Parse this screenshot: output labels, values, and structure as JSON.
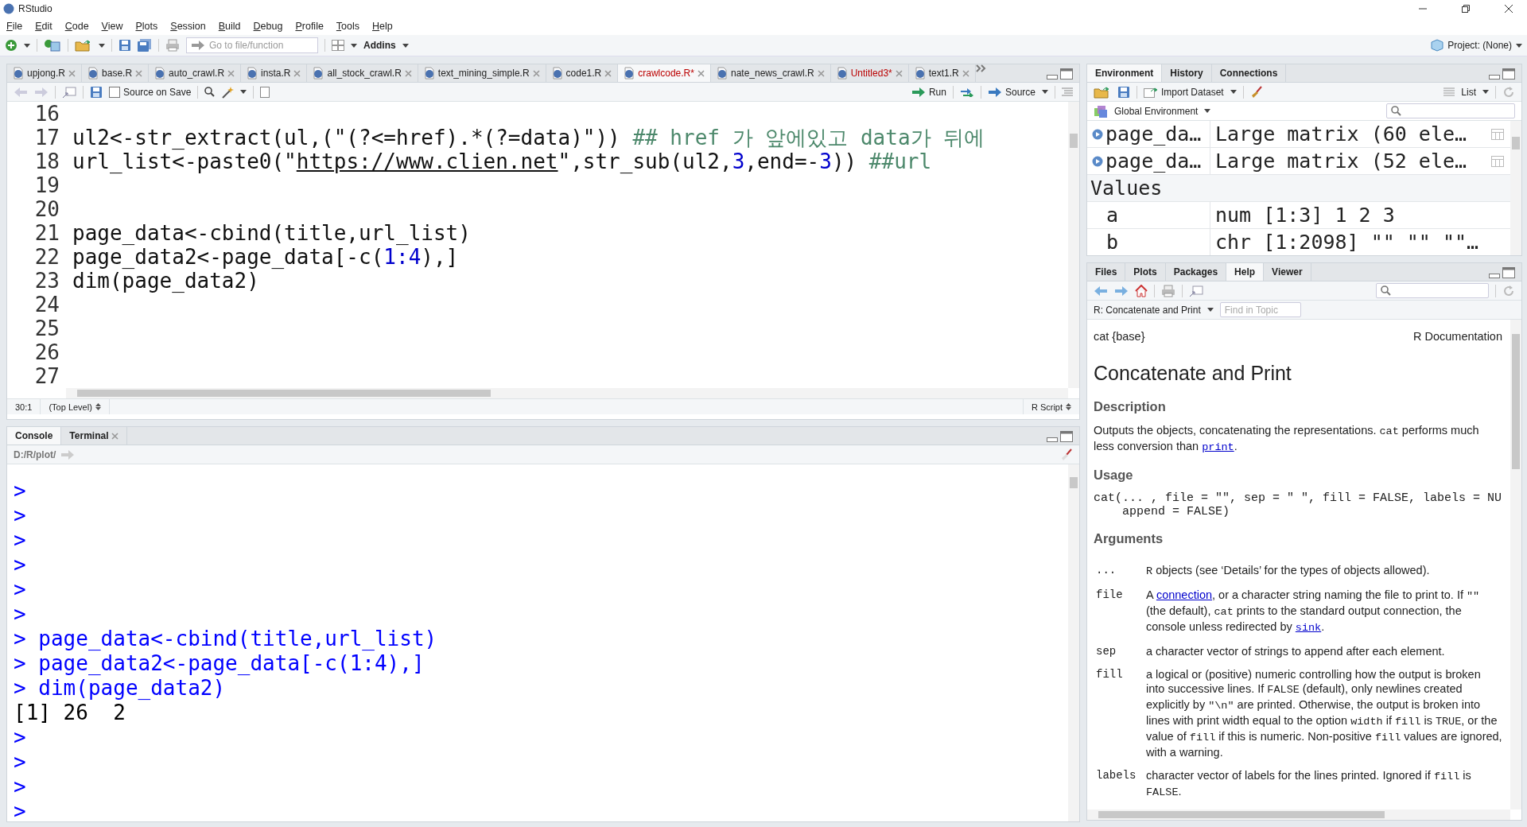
{
  "window": {
    "title": "RStudio"
  },
  "menu": [
    "File",
    "Edit",
    "Code",
    "View",
    "Plots",
    "Session",
    "Build",
    "Debug",
    "Profile",
    "Tools",
    "Help"
  ],
  "toolbar": {
    "goto_placeholder": "Go to file/function",
    "addins": "Addins",
    "project": "Project: (None)"
  },
  "source": {
    "tabs": [
      {
        "label": "upjong.R",
        "selected": false,
        "modified": false
      },
      {
        "label": "base.R",
        "selected": false,
        "modified": false
      },
      {
        "label": "auto_crawl.R",
        "selected": false,
        "modified": false
      },
      {
        "label": "insta.R",
        "selected": false,
        "modified": false
      },
      {
        "label": "all_stock_crawl.R",
        "selected": false,
        "modified": false
      },
      {
        "label": "text_mining_simple.R",
        "selected": false,
        "modified": false
      },
      {
        "label": "code1.R",
        "selected": false,
        "modified": false
      },
      {
        "label": "crawlcode.R*",
        "selected": true,
        "modified": true
      },
      {
        "label": "nate_news_crawl.R",
        "selected": false,
        "modified": false
      },
      {
        "label": "Untitled3*",
        "selected": false,
        "modified": true
      },
      {
        "label": "text1.R",
        "selected": false,
        "modified": false
      }
    ],
    "source_on_save": {
      "label": "Source on Save",
      "checked": false
    },
    "run": "Run",
    "source_button": "Source",
    "lines": [
      {
        "number": "16"
      },
      {
        "number": "17",
        "segments": [
          {
            "kind": "plain",
            "text": "ul2<-str_extract(ul,(\"(?<=href).*(?=data)\"))"
          },
          {
            "kind": "comment",
            "text": " ## href 가 앞에있고 data가 뒤에"
          }
        ]
      },
      {
        "number": "18",
        "segments": [
          {
            "kind": "plain",
            "text": "url_list<-paste0(\""
          },
          {
            "kind": "link",
            "text": "https://www.clien.net"
          },
          {
            "kind": "plain",
            "text": "\",str_sub(ul2,"
          },
          {
            "kind": "number",
            "text": "3"
          },
          {
            "kind": "plain",
            "text": ",end=-"
          },
          {
            "kind": "number",
            "text": "3"
          },
          {
            "kind": "plain",
            "text": "))"
          },
          {
            "kind": "comment",
            "text": " ##url"
          }
        ]
      },
      {
        "number": "19"
      },
      {
        "number": "20"
      },
      {
        "number": "21",
        "segments": [
          {
            "kind": "plain",
            "text": "page_data<-cbind(title,url_list)"
          }
        ]
      },
      {
        "number": "22",
        "segments": [
          {
            "kind": "plain",
            "text": "page_data2<-page_data[-c("
          },
          {
            "kind": "number",
            "text": "1:4"
          },
          {
            "kind": "plain",
            "text": "),]"
          }
        ]
      },
      {
        "number": "23",
        "segments": [
          {
            "kind": "plain",
            "text": "dim(page_data2)"
          }
        ]
      },
      {
        "number": "24"
      },
      {
        "number": "25"
      },
      {
        "number": "26"
      },
      {
        "number": "27"
      }
    ],
    "status": {
      "position": "30:1",
      "scope": "(Top Level)",
      "filetype": "R Script"
    }
  },
  "console": {
    "tabs": [
      {
        "label": "Console",
        "selected": true,
        "closable": false
      },
      {
        "label": "Terminal",
        "selected": false,
        "closable": true
      }
    ],
    "path": "D:/R/plot/",
    "lines": [
      {
        "kind": "input",
        "prompt": ">"
      },
      {
        "kind": "input",
        "prompt": ">"
      },
      {
        "kind": "input",
        "prompt": ">"
      },
      {
        "kind": "input",
        "prompt": ">"
      },
      {
        "kind": "input",
        "prompt": ">"
      },
      {
        "kind": "input",
        "prompt": ">"
      },
      {
        "kind": "input",
        "prompt": ">",
        "text": "page_data<-cbind(title,url_list)"
      },
      {
        "kind": "input",
        "prompt": ">",
        "text": "page_data2<-page_data[-c(1:4),]"
      },
      {
        "kind": "input",
        "prompt": ">",
        "text": "dim(page_data2)"
      },
      {
        "kind": "output",
        "text": "[1] 26  2"
      },
      {
        "kind": "input",
        "prompt": ">"
      },
      {
        "kind": "input",
        "prompt": ">"
      },
      {
        "kind": "input",
        "prompt": ">"
      },
      {
        "kind": "input",
        "prompt": ">"
      }
    ]
  },
  "environment": {
    "tabs": [
      {
        "label": "Environment",
        "selected": true
      },
      {
        "label": "History",
        "selected": false
      },
      {
        "label": "Connections",
        "selected": false
      }
    ],
    "import_dataset": "Import Dataset",
    "view_mode": "List",
    "scope": "Global Environment",
    "rows": [
      {
        "kind": "data",
        "name": "page_da…",
        "value": "Large matrix (60 ele…"
      },
      {
        "kind": "data",
        "name": "page_da…",
        "value": "Large matrix (52 ele…"
      },
      {
        "kind": "header",
        "name": "Values"
      },
      {
        "kind": "value",
        "name": "a",
        "value": "num [1:3] 1 2 3"
      },
      {
        "kind": "value",
        "name": "b",
        "value": "chr [1:2098] \"\" \"\" \"\"…"
      }
    ]
  },
  "files": {
    "tabs": [
      {
        "label": "Files",
        "selected": false
      },
      {
        "label": "Plots",
        "selected": false
      },
      {
        "label": "Packages",
        "selected": false
      },
      {
        "label": "Help",
        "selected": true
      },
      {
        "label": "Viewer",
        "selected": false
      }
    ],
    "topic": "R: Concatenate and Print",
    "find_placeholder": "Find in Topic",
    "help": {
      "package": "cat {base}",
      "doc_label": "R Documentation",
      "title": "Concatenate and Print",
      "sections": [
        {
          "heading": "Description",
          "paragraph": [
            {
              "kind": "text",
              "text": "Outputs the objects, concatenating the representations. "
            },
            {
              "kind": "code",
              "text": "cat"
            },
            {
              "kind": "text",
              "text": " performs much less conversion than "
            },
            {
              "kind": "code-link",
              "text": "print"
            },
            {
              "kind": "text",
              "text": "."
            }
          ]
        },
        {
          "heading": "Usage",
          "code": [
            "cat(... , file = \"\", sep = \" \", fill = FALSE, labels = NU",
            "    append = FALSE)"
          ]
        },
        {
          "heading": "Arguments",
          "arguments": [
            {
              "name": "...",
              "description": [
                {
                  "kind": "code",
                  "text": "R"
                },
                {
                  "kind": "text",
                  "text": " objects (see ‘Details’ for the types of objects allowed)."
                }
              ]
            },
            {
              "name": "file",
              "description": [
                {
                  "kind": "text",
                  "text": "A "
                },
                {
                  "kind": "link",
                  "text": "connection"
                },
                {
                  "kind": "text",
                  "text": ", or a character string naming the file to print to. If "
                },
                {
                  "kind": "code",
                  "text": "\"\""
                },
                {
                  "kind": "text",
                  "text": " (the default), "
                },
                {
                  "kind": "code",
                  "text": "cat"
                },
                {
                  "kind": "text",
                  "text": " prints to the standard output connection, the console unless redirected by "
                },
                {
                  "kind": "code-link",
                  "text": "sink"
                },
                {
                  "kind": "text",
                  "text": "."
                }
              ]
            },
            {
              "name": "sep",
              "description": [
                {
                  "kind": "text",
                  "text": "a character vector of strings to append after each element."
                }
              ]
            },
            {
              "name": "fill",
              "description": [
                {
                  "kind": "text",
                  "text": "a logical or (positive) numeric controlling how the output is broken into successive lines. If "
                },
                {
                  "kind": "code",
                  "text": "FALSE"
                },
                {
                  "kind": "text",
                  "text": " (default), only newlines created explicitly by "
                },
                {
                  "kind": "code",
                  "text": "\"\\n\""
                },
                {
                  "kind": "text",
                  "text": " are printed. Otherwise, the output is broken into lines with print width equal to the option "
                },
                {
                  "kind": "code",
                  "text": "width"
                },
                {
                  "kind": "text",
                  "text": " if "
                },
                {
                  "kind": "code",
                  "text": "fill"
                },
                {
                  "kind": "text",
                  "text": " is "
                },
                {
                  "kind": "code",
                  "text": "TRUE"
                },
                {
                  "kind": "text",
                  "text": ", or the value of "
                },
                {
                  "kind": "code",
                  "text": "fill"
                },
                {
                  "kind": "text",
                  "text": " if this is numeric. Non-positive "
                },
                {
                  "kind": "code",
                  "text": "fill"
                },
                {
                  "kind": "text",
                  "text": " values are ignored, with a warning."
                }
              ]
            },
            {
              "name": "labels",
              "description": [
                {
                  "kind": "text",
                  "text": "character vector of labels for the lines printed. Ignored if "
                },
                {
                  "kind": "code",
                  "text": "fill"
                },
                {
                  "kind": "text",
                  "text": " is "
                },
                {
                  "kind": "code",
                  "text": "FALSE"
                },
                {
                  "kind": "text",
                  "text": "."
                }
              ]
            }
          ]
        }
      ]
    }
  }
}
